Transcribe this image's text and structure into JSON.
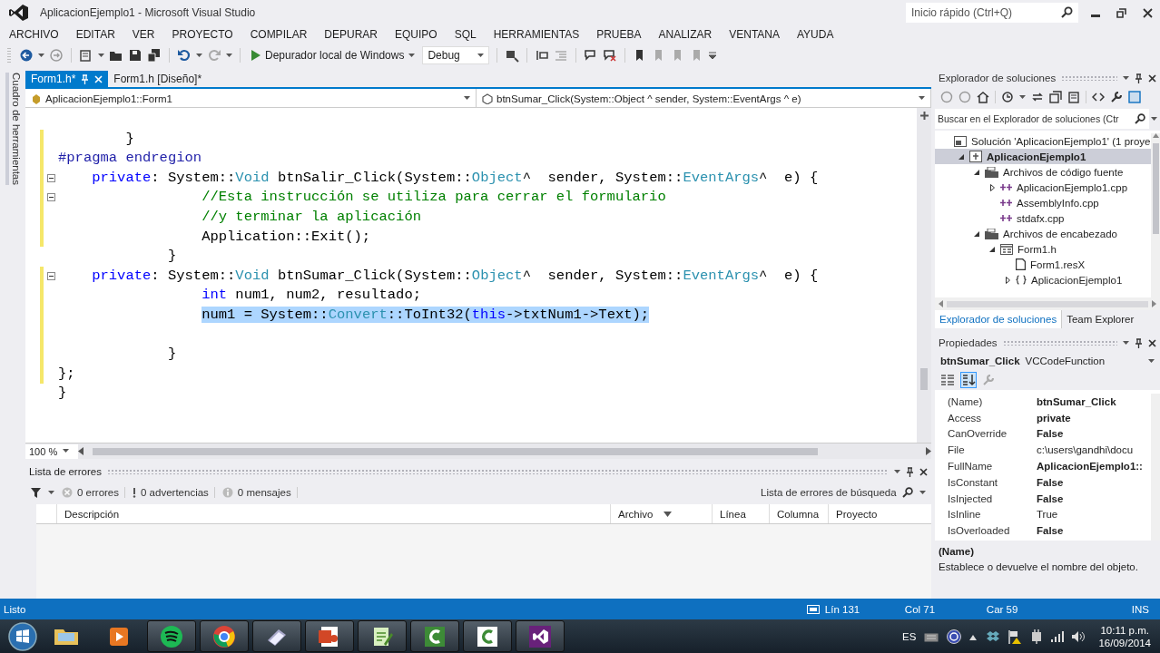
{
  "window": {
    "title": "AplicacionEjemplo1 - Microsoft Visual Studio",
    "quick_launch": {
      "placeholder": "Inicio rápido (Ctrl+Q)"
    }
  },
  "menu": [
    "ARCHIVO",
    "EDITAR",
    "VER",
    "PROYECTO",
    "COMPILAR",
    "DEPURAR",
    "EQUIPO",
    "SQL",
    "HERRAMIENTAS",
    "PRUEBA",
    "ANALIZAR",
    "VENTANA",
    "AYUDA"
  ],
  "toolbar": {
    "debugger": "Depurador local de Windows",
    "configuration": "Debug"
  },
  "toolbox_tab": "Cuadro de herramientas",
  "editor": {
    "tabs": [
      {
        "label": "Form1.h*",
        "selected": true
      },
      {
        "label": "Form1.h [Diseño]*",
        "selected": false
      }
    ],
    "scope": "AplicacionEjemplo1::Form1",
    "member": "btnSumar_Click(System::Object ^ sender, System::EventArgs ^ e)",
    "zoom": "100 %",
    "lines": [
      {
        "fold": false,
        "changed": true,
        "selected": false,
        "code": [
          {
            "kind": "plain",
            "text": "        }"
          }
        ]
      },
      {
        "fold": false,
        "changed": true,
        "selected": false,
        "code": [
          {
            "kind": "pre",
            "text": "#pragma endregion"
          }
        ]
      },
      {
        "fold": true,
        "changed": true,
        "selected": false,
        "code": [
          {
            "kind": "kw",
            "text": "    private"
          },
          {
            "kind": "plain",
            "text": ": System::"
          },
          {
            "kind": "type",
            "text": "Void"
          },
          {
            "kind": "plain",
            "text": " btnSalir_Click(System::"
          },
          {
            "kind": "type",
            "text": "Object"
          },
          {
            "kind": "plain",
            "text": "^  sender, System::"
          },
          {
            "kind": "type",
            "text": "EventArgs"
          },
          {
            "kind": "plain",
            "text": "^  e) {"
          }
        ]
      },
      {
        "fold": true,
        "changed": true,
        "selected": false,
        "code": [
          {
            "kind": "comment",
            "text": "                 //Esta instrucción se utiliza para cerrar el formulario"
          }
        ]
      },
      {
        "fold": false,
        "changed": true,
        "selected": false,
        "code": [
          {
            "kind": "comment",
            "text": "                 //y terminar la aplicación"
          }
        ]
      },
      {
        "fold": false,
        "changed": true,
        "selected": false,
        "code": [
          {
            "kind": "plain",
            "text": "                 Application::Exit();"
          }
        ]
      },
      {
        "fold": false,
        "changed": false,
        "selected": false,
        "code": [
          {
            "kind": "plain",
            "text": "             }"
          }
        ]
      },
      {
        "fold": true,
        "changed": true,
        "selected": false,
        "code": [
          {
            "kind": "kw",
            "text": "    private"
          },
          {
            "kind": "plain",
            "text": ": System::"
          },
          {
            "kind": "type",
            "text": "Void"
          },
          {
            "kind": "plain",
            "text": " btnSumar_Click(System::"
          },
          {
            "kind": "type",
            "text": "Object"
          },
          {
            "kind": "plain",
            "text": "^  sender, System::"
          },
          {
            "kind": "type",
            "text": "EventArgs"
          },
          {
            "kind": "plain",
            "text": "^  e) {"
          }
        ]
      },
      {
        "fold": false,
        "changed": true,
        "selected": false,
        "code": [
          {
            "kind": "kw",
            "text": "                 int"
          },
          {
            "kind": "plain",
            "text": " num1, num2, resultado;"
          }
        ]
      },
      {
        "fold": false,
        "changed": true,
        "selected": true,
        "code": [
          {
            "kind": "plain",
            "text": "                 num1 = System::"
          },
          {
            "kind": "type",
            "text": "Convert"
          },
          {
            "kind": "plain",
            "text": "::ToInt32("
          },
          {
            "kind": "kw",
            "text": "this"
          },
          {
            "kind": "plain",
            "text": "->txtNum1->Text);"
          }
        ]
      },
      {
        "fold": false,
        "changed": true,
        "selected": false
      },
      {
        "fold": false,
        "changed": true,
        "selected": false,
        "code": [
          {
            "kind": "plain",
            "text": "             }"
          }
        ]
      },
      {
        "fold": false,
        "changed": true,
        "selected": false,
        "code": [
          {
            "kind": "plain",
            "text": "};"
          }
        ]
      },
      {
        "fold": false,
        "changed": false,
        "selected": false,
        "code": [
          {
            "kind": "plain",
            "text": "}"
          }
        ]
      }
    ]
  },
  "error_list": {
    "title": "Lista de errores",
    "filters": [
      {
        "kind": "error",
        "label": "0 errores"
      },
      {
        "kind": "warning",
        "label": "0 advertencias"
      },
      {
        "kind": "info",
        "label": "0 mensajes"
      }
    ],
    "search": {
      "placeholder": "Lista de errores de búsqueda"
    },
    "columns": [
      "Descripción",
      "Archivo",
      "Línea",
      "Columna",
      "Proyecto"
    ]
  },
  "solution_explorer": {
    "title": "Explorador de soluciones",
    "search": {
      "placeholder": "Buscar en el Explorador de soluciones (Ctr"
    },
    "tree": [
      {
        "kind": "solution",
        "label": "Solución 'AplicacionEjemplo1' (1 proye",
        "selected": false,
        "children": [
          {
            "kind": "project",
            "label": "AplicacionEjemplo1",
            "selected": true,
            "expanded": true,
            "children": [
              {
                "kind": "folder",
                "label": "Archivos de código fuente",
                "selected": false,
                "expanded": true,
                "children": [
                  {
                    "kind": "cpp",
                    "label": "AplicacionEjemplo1.cpp",
                    "selected": false,
                    "expanded": false
                  },
                  {
                    "kind": "cpp",
                    "label": "AssemblyInfo.cpp",
                    "selected": false
                  },
                  {
                    "kind": "cpp",
                    "label": "stdafx.cpp",
                    "selected": false
                  }
                ]
              },
              {
                "kind": "folder",
                "label": "Archivos de encabezado",
                "selected": false,
                "expanded": true,
                "children": [
                  {
                    "kind": "form",
                    "label": "Form1.h",
                    "selected": false,
                    "expanded": true,
                    "children": [
                      {
                        "kind": "file",
                        "label": "Form1.resX",
                        "selected": false
                      },
                      {
                        "kind": "class",
                        "label": "AplicacionEjemplo1",
                        "selected": false,
                        "expanded": false
                      }
                    ]
                  }
                ]
              }
            ]
          }
        ]
      }
    ],
    "tabs": [
      {
        "label": "Explorador de soluciones",
        "selected": true
      },
      {
        "label": "Team Explorer",
        "selected": false
      }
    ]
  },
  "properties": {
    "title": "Propiedades",
    "object_name": "btnSumar_Click",
    "object_type": "VCCodeFunction",
    "rows": [
      {
        "name": "(Name)",
        "value": "btnSumar_Click",
        "bold": true
      },
      {
        "name": "Access",
        "value": "private",
        "bold": true
      },
      {
        "name": "CanOverride",
        "value": "False",
        "bold": true
      },
      {
        "name": "File",
        "value": "c:\\users\\gandhi\\docu",
        "bold": false
      },
      {
        "name": "FullName",
        "value": "AplicacionEjemplo1::",
        "bold": true
      },
      {
        "name": "IsConstant",
        "value": "False",
        "bold": true
      },
      {
        "name": "IsInjected",
        "value": "False",
        "bold": true
      },
      {
        "name": "IsInline",
        "value": "True",
        "bold": false
      },
      {
        "name": "IsOverloaded",
        "value": "False",
        "bold": true
      }
    ],
    "description_title": "(Name)",
    "description": "Establece o devuelve el nombre del objeto."
  },
  "status_bar": {
    "message": "Listo",
    "line": "Lín 131",
    "column": "Col 71",
    "char": "Car 59",
    "mode": "INS"
  },
  "taskbar": {
    "language": "ES",
    "time": "10:11 p.m.",
    "date": "16/09/2014"
  }
}
